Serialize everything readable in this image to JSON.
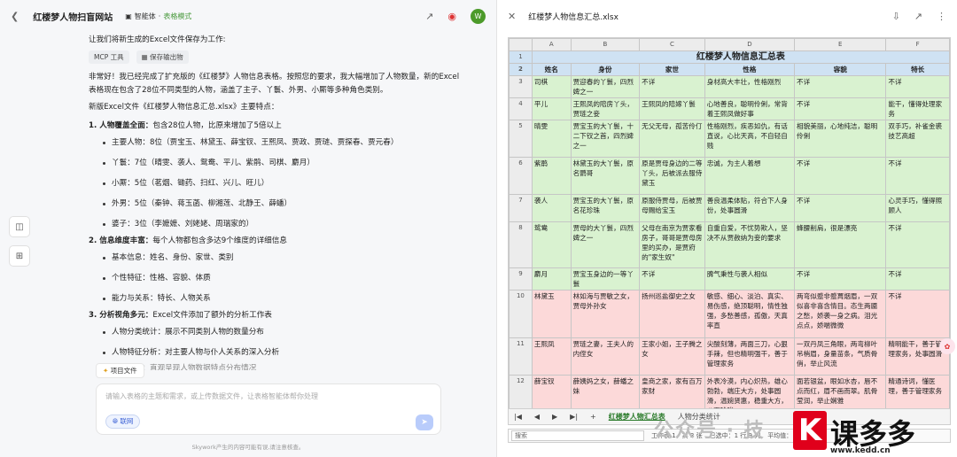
{
  "left": {
    "header": {
      "title": "红楼梦人物扫盲网站",
      "agent": "智能体",
      "mode": "表格模式",
      "avatar": "W"
    },
    "intro": "让我们将新生成的Excel文件保存为工作:",
    "chips": [
      "MCP 工具",
      "保存输出物"
    ],
    "para1": "非常好！我已经完成了扩充版的《红楼梦》人物信息表格。按照您的要求，我大幅增加了人物数量，新的Excel表格现在包含了28位不同类型的人物，涵盖了主子、丫鬟、外男、小厮等多种角色类别。",
    "para2": "新版Excel文件《红楼梦人物信息汇总.xlsx》主要特点：",
    "sec1": {
      "head": "1. 人物覆盖全面：",
      "desc": "包含28位人物，比原来增加了5倍以上",
      "items": [
        "主要人物：8位（贾宝玉、林黛玉、薛宝钗、王熙凤、贾政、贾琏、贾探春、贾元春）",
        "丫鬟：7位（晴雯、袭人、鸳鸯、平儿、紫鹃、司棋、麝月）",
        "小厮：5位（茗烟、锄药、扫红、兴儿、旺儿）",
        "外男：5位（秦钟、蒋玉菡、柳湘莲、北静王、薛蟠）",
        "婆子：3位（李嬷嬷、刘姥姥、周瑞家的）"
      ]
    },
    "sec2": {
      "head": "2. 信息维度丰富：",
      "desc": "每个人物都包含多达9个维度的详细信息",
      "items": [
        "基本信息：姓名、身份、家世、类别",
        "个性特征：性格、容貌、体质",
        "能力与关系：特长、人物关系"
      ]
    },
    "sec3": {
      "head": "3. 分析视角多元：",
      "desc": "Excel文件添加了额外的分析工作表",
      "items": [
        "人物分类统计：展示不同类别人物的数量分布",
        "人物特征分析：对主要人物与仆人关系的深入分析",
        "图表展示：直观呈现人物数据特点分布情况"
      ]
    },
    "project_file": "项目文件",
    "input_placeholder": "请输入表格的主题和需求，或上传数据文件，让表格智能体帮你处理",
    "web_button": "联网",
    "footer": "Skywork产生的内容可能有误,请注意核查。"
  },
  "right": {
    "file_title": "红楼梦人物信息汇总.xlsx",
    "columns": [
      "A",
      "B",
      "C",
      "D",
      "E",
      "F"
    ],
    "sheet_title": "红楼梦人物信息汇总表",
    "headers": [
      "姓名",
      "身份",
      "家世",
      "性格",
      "容貌",
      "特长"
    ],
    "rows": [
      {
        "n": "3",
        "tone": "green",
        "c": [
          "司棋",
          "贾迎春的丫鬟，四烈婢之一",
          "不详",
          "身材高大丰壮，性格刚烈",
          "不详",
          "不详"
        ]
      },
      {
        "n": "4",
        "tone": "green",
        "c": [
          "平儿",
          "王熙凤的陪房丫头，贾琏之妾",
          "王熙凤的陪嫁丫鬟",
          "心地善良，聪明伶俐，常背着王熙凤做好事",
          "不详",
          "能干，懂得处理家务"
        ]
      },
      {
        "n": "5",
        "tone": "green",
        "c": [
          "晴雯",
          "贾宝玉的大丫鬟，十二下钗之首，四烈婢之一",
          "无父无母，孤苦伶仃",
          "性格刚烈，疾恶如仇，有话直说，心比天高，不自轻自贱",
          "相貌美丽，心地纯洁，聪明伶俐",
          "双手巧，补雀金裘技艺高超"
        ]
      },
      {
        "n": "6",
        "tone": "green",
        "c": [
          "紫鹃",
          "林黛玉的大丫鬟，原名鹦哥",
          "原是贾母身边的二等丫头，后被派去服侍黛玉",
          "忠诚，为主人着想",
          "不详",
          "不详"
        ]
      },
      {
        "n": "7",
        "tone": "green",
        "c": [
          "袭人",
          "贾宝玉的大丫鬟，原名花珍珠",
          "原服侍贾母，后被贾母赐给宝玉",
          "善良温柔体贴，符合下人身份，处事圆滑",
          "不详",
          "心灵手巧，懂得照顾人"
        ]
      },
      {
        "n": "8",
        "tone": "green",
        "c": [
          "鸳鸯",
          "贾母的大丫鬟，四烈婢之一",
          "父母在南京为贾家看房子，哥哥是贾母房里的买办，是贾府的\"家生奴\"",
          "自重自爱，不忧势欺人，坚决不从贾赦纳为妾的要求",
          "蜂腰削肩，很是漂亮",
          "不详"
        ]
      },
      {
        "n": "9",
        "tone": "green",
        "c": [
          "麝月",
          "贾宝玉身边的一等丫鬟",
          "不详",
          "脾气秉性与袭人相似",
          "不详",
          "不详"
        ]
      },
      {
        "n": "10",
        "tone": "red",
        "c": [
          "林黛玉",
          "林如海与贾敏之女，贾母外孙女",
          "扬州巡盐御史之女",
          "敏感、细心、淡泊、真实、易伤感，绝顶聪明，情性独强，多愁善感，孤傲，天真率直",
          "两弯似蹙非蹙罥烟眉，一双似喜非喜含情目。态生两靥之愁，娇袭一身之病。泪光点点，娇喘微微",
          "不详"
        ]
      },
      {
        "n": "11",
        "tone": "red",
        "c": [
          "王熙凤",
          "贾琏之妻，王夫人的内侄女",
          "王家小姐，王子腾之女",
          "尖酸刻薄，两面三刀，心狠手辣，但也精明强干，善于管理家务",
          "一双丹凤三角眼，两弯柳叶吊梢眉，身量苗条，气质骨俏，举止风流",
          "精明能干，善于管理家务，处事圆滑"
        ]
      },
      {
        "n": "12",
        "tone": "red",
        "c": [
          "薛宝钗",
          "薛姨妈之女，薛蟠之妹",
          "皇商之家，家有百万家财",
          "外表冷漠，内心炽热，雄心勃勃，端庄大方，处事圆滑，温婉贤惠，稳重大方，八面玲珑",
          "面若银盆，眼如水杏，唇不点而红，眉不画而翠。肌骨莹润，举止娴雅",
          "精通诗词，懂医理，善于管理家务"
        ]
      }
    ],
    "tabs": [
      "红楼梦人物汇总表",
      "人物分类统计"
    ],
    "status": {
      "search": "搜索",
      "sheetinfo": "工作表 1，共 3 张",
      "selected": "已选中：1 行 9 列",
      "avg": "平均值："
    },
    "watermark": "公众号 · 技",
    "logo": {
      "k": "K",
      "brand": "课多多",
      "url": "www.kedd.cn"
    }
  }
}
